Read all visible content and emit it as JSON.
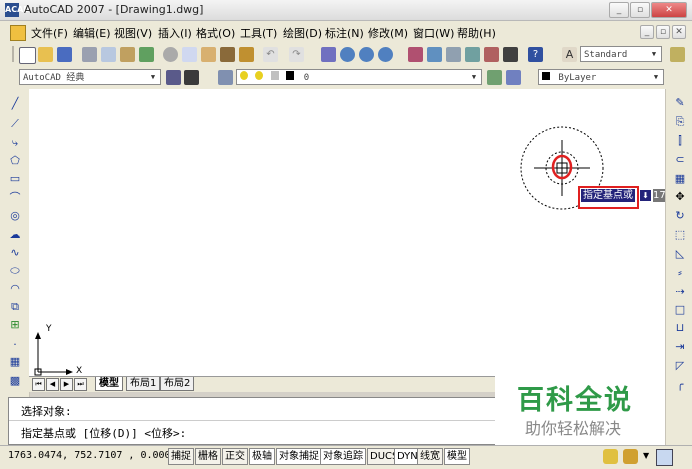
{
  "window": {
    "title": "AutoCAD 2007 - [Drawing1.dwg]",
    "app_icon_label": "ACAD",
    "controls": [
      "_",
      "▫",
      "✕"
    ],
    "doc_controls": [
      "_",
      "▫",
      "✕"
    ]
  },
  "menu": {
    "items": [
      "文件(F)",
      "编辑(E)",
      "视图(V)",
      "插入(I)",
      "格式(O)",
      "工具(T)",
      "绘图(D)",
      "标注(N)",
      "修改(M)",
      "窗口(W)",
      "帮助(H)"
    ]
  },
  "toolbar": {
    "text_style": "Standard"
  },
  "toolbar2": {
    "workspace": "AutoCAD 经典",
    "layer": "0",
    "color": "ByLayer"
  },
  "canvas": {
    "ucs_x": "X",
    "ucs_y": "Y",
    "prompt_tooltip": "指定基点或",
    "coord_tooltip": "1763.04"
  },
  "tabs": {
    "items": [
      "模型",
      "布局1",
      "布局2"
    ]
  },
  "command": {
    "line1": "选择对象:",
    "line2": "指定基点或 [位移(D)] <位移>:"
  },
  "watermark": {
    "title": "百科全说",
    "subtitle": "助你轻松解决"
  },
  "status": {
    "coords": "1763.0474, 752.7107 , 0.0000",
    "toggles": [
      "捕捉",
      "栅格",
      "正交",
      "极轴",
      "对象捕捉",
      "对象追踪",
      "DUCS",
      "DYN",
      "线宽",
      "模型"
    ]
  }
}
